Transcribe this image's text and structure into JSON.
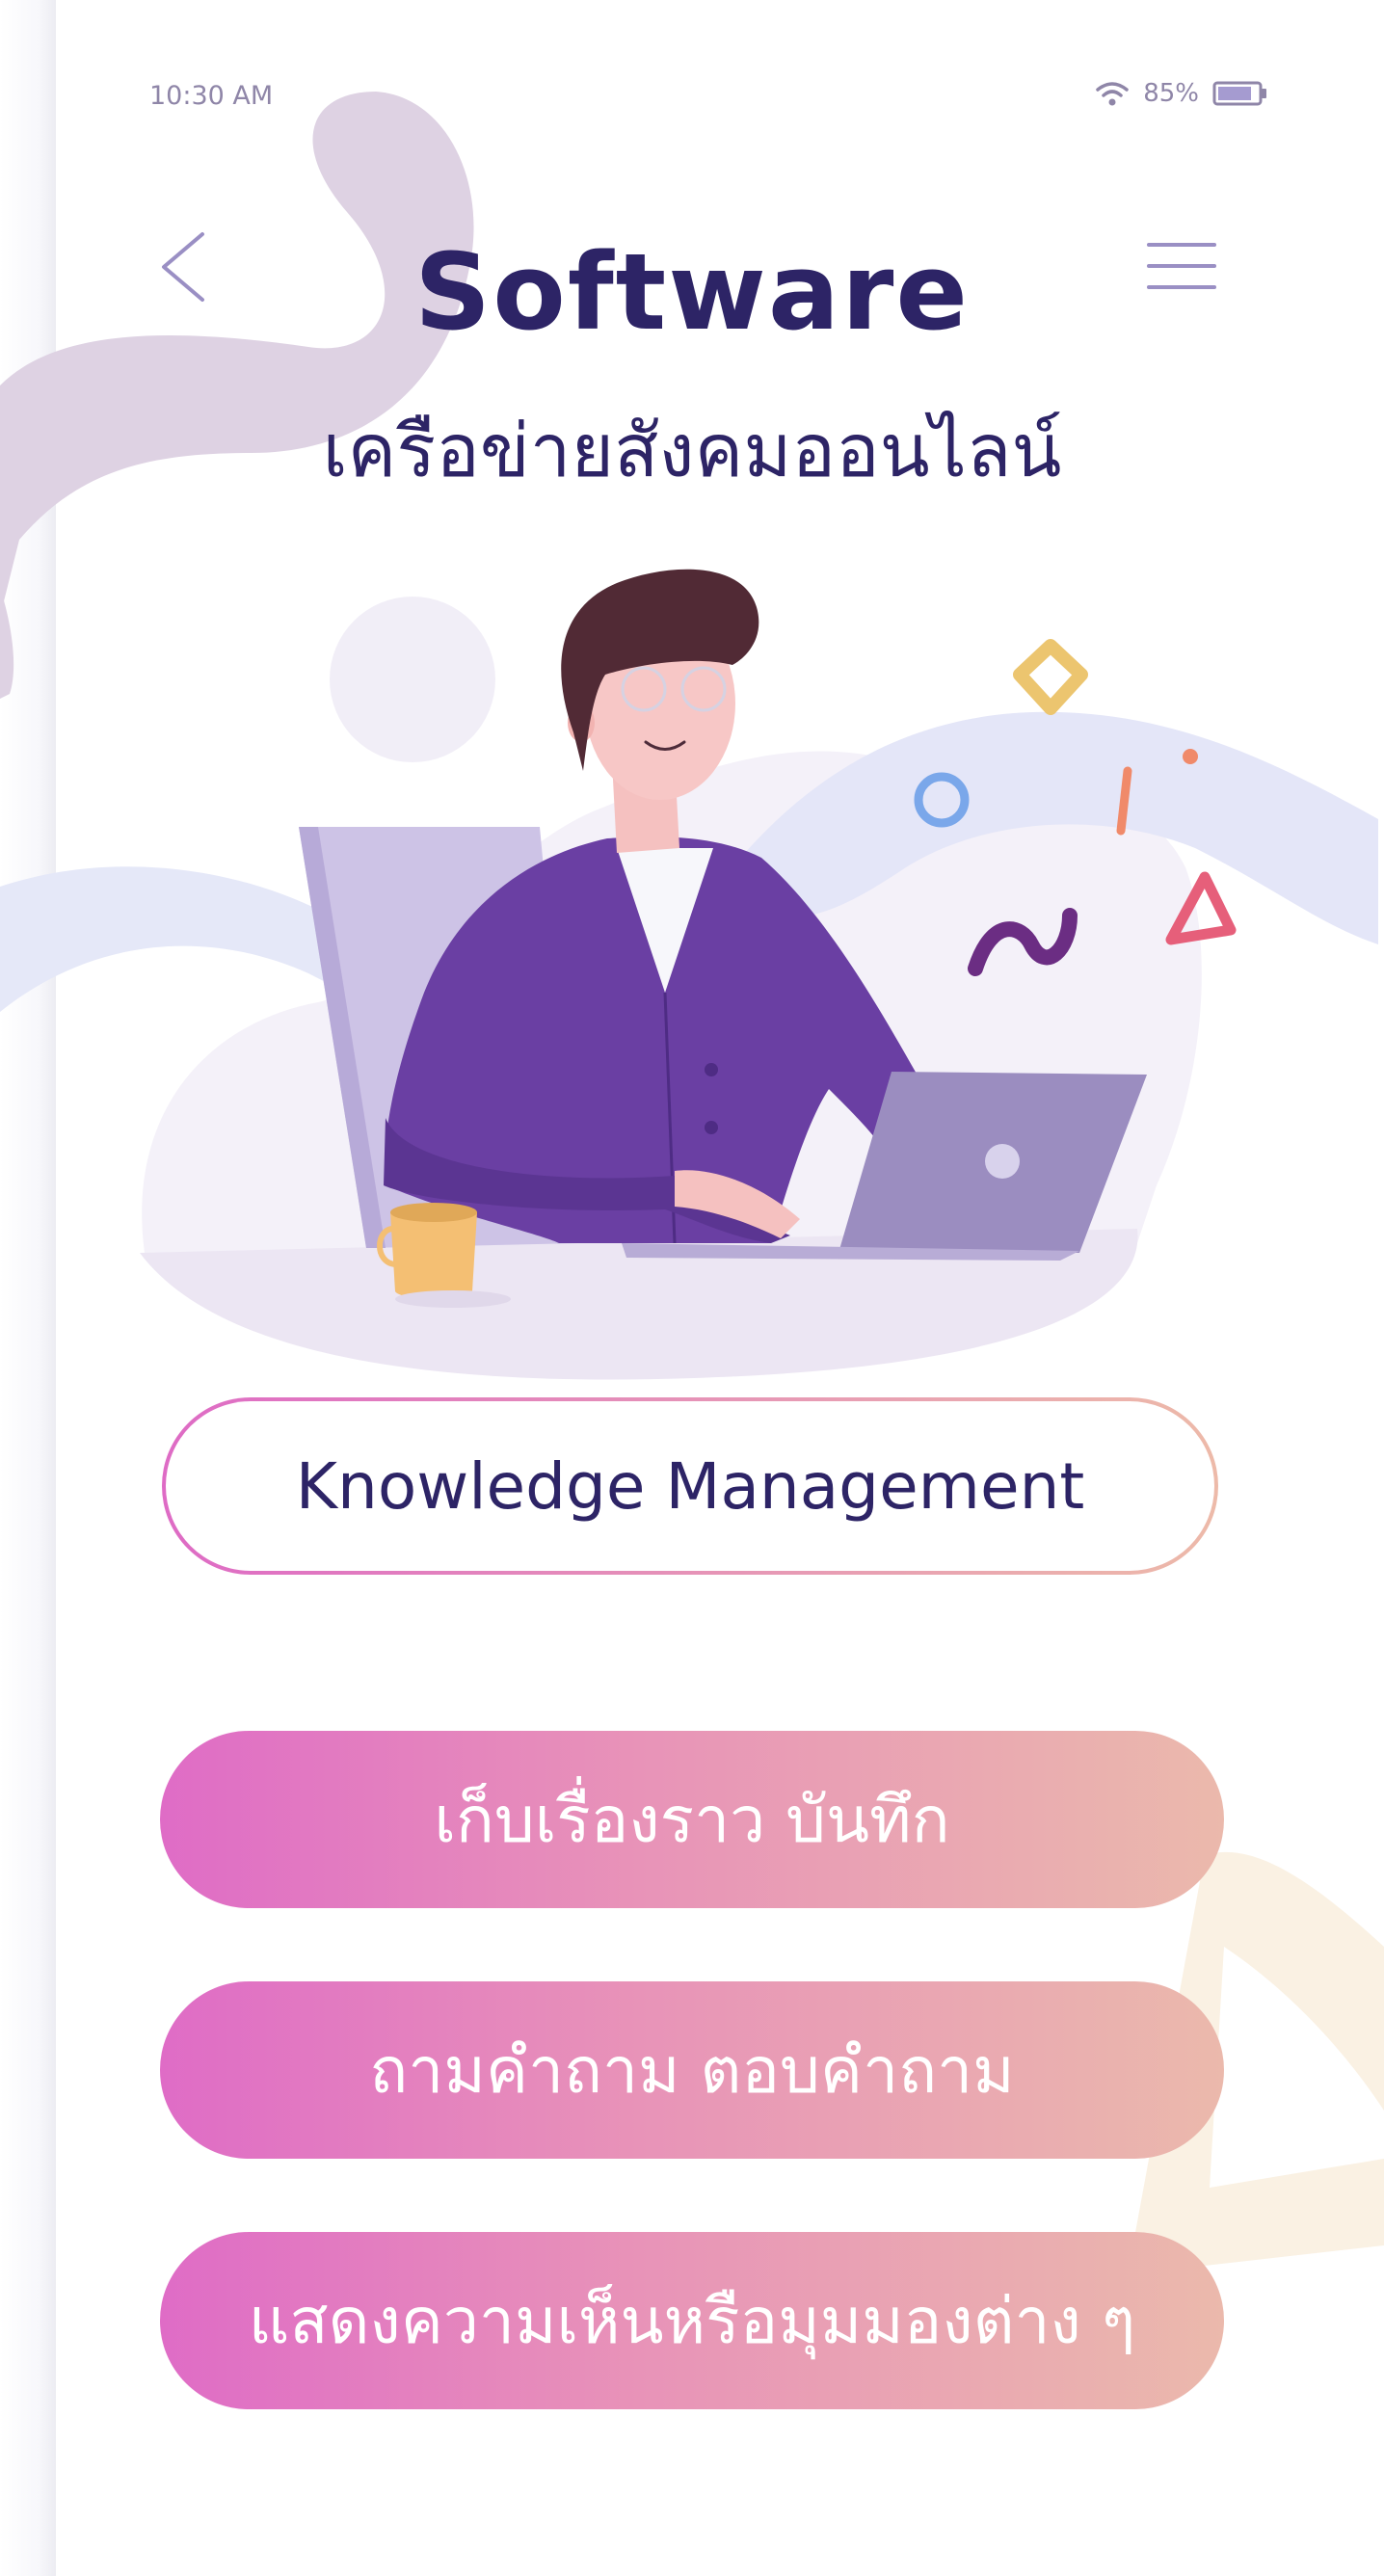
{
  "status_bar": {
    "time": "10:30 AM",
    "battery_percent": "85%",
    "battery_level": 0.85,
    "icons": [
      "wifi-icon",
      "battery-icon"
    ]
  },
  "header": {
    "back_icon": "chevron-left-icon",
    "menu_icon": "hamburger-menu-icon",
    "title": "Software",
    "subtitle": "เครือข่ายสังคมออนไลน์"
  },
  "illustration": {
    "subject": "man-at-laptop-illustration"
  },
  "main": {
    "knowledge_button": "Knowledge Management",
    "actions": [
      {
        "label": "เก็บเรื่องราว บันทึก"
      },
      {
        "label": "ถามคำถาม ตอบคำถาม"
      },
      {
        "label": "แสดงความเห็นหรือมุมมองต่าง ๆ"
      }
    ]
  },
  "colors": {
    "primary_text": "#2d2466",
    "gradient_start": "#df6cc6",
    "gradient_end": "#ebb9ac",
    "status_text": "#8f86a8",
    "jacket": "#6a3fa3"
  }
}
